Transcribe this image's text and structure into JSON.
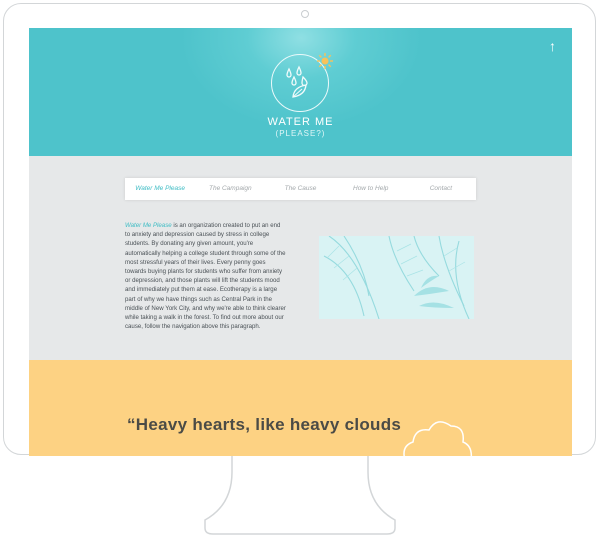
{
  "header": {
    "title": "WATER ME",
    "subtitle": "(PLEASE?)",
    "back_to_top_icon": "arrow-up-icon"
  },
  "nav": {
    "items": [
      {
        "label": "Water Me Please"
      },
      {
        "label": "The Campaign"
      },
      {
        "label": "The Cause"
      },
      {
        "label": "How to Help"
      },
      {
        "label": "Contact"
      }
    ]
  },
  "about": {
    "highlight": "Water Me Please",
    "body": " is an organization created to put an end to anxiety and depression caused by stress in college students. By donating any given amount, you're automatically helping a college student through some of the most stressful years of their lives. Every penny goes towards buying plants for students who suffer from anxiety or depression, and those plants will lift the students mood and immediately put them at ease. Ecotherapy is a large part of why we have things such as Central Park in the middle of New York City, and why we're able to think clearer while taking a walk in the forest. To find out more about our cause, follow the navigation above this paragraph."
  },
  "quote": {
    "text": "“Heavy hearts, like heavy clouds"
  },
  "colors": {
    "teal": "#4ec3cb",
    "accent": "#3ebcc4",
    "yellow": "#fdd283",
    "screen_bg": "#e6e8e9"
  }
}
